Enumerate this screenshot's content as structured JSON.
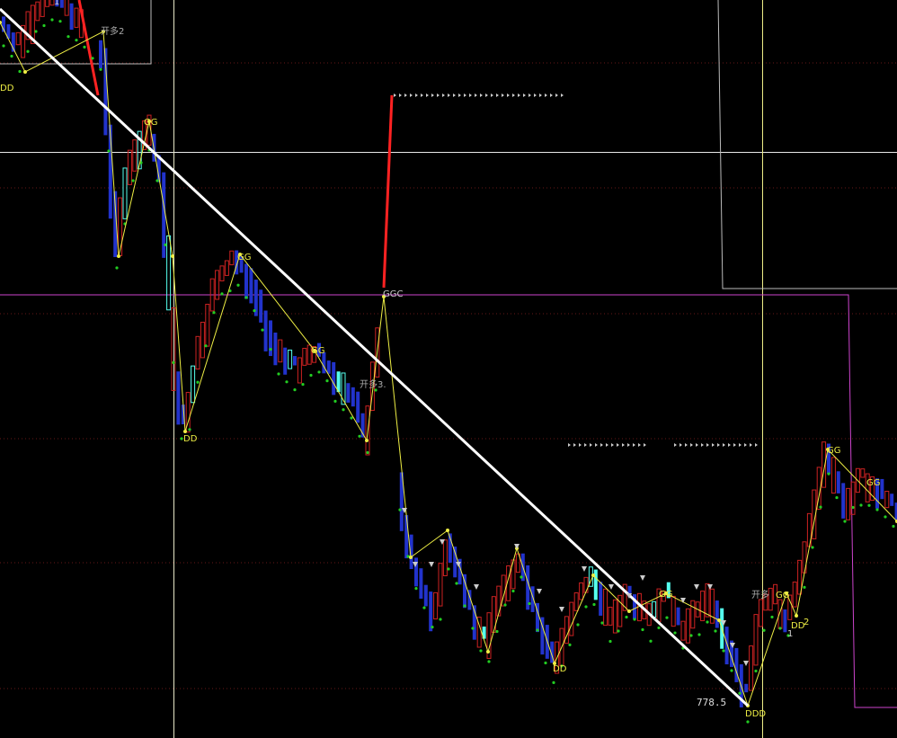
{
  "chart_data": {
    "type": "candlestick",
    "title": "",
    "xlabel": "",
    "ylabel": "",
    "grid": true,
    "colors": {
      "background": "#000000",
      "up_candle": "#cc2222",
      "down_candle": "#2233cc",
      "highlight_candle": "#55ffee",
      "trend_line": "#ffffff",
      "zigzag": "#eeee44",
      "dotted_trend": "#22cc22",
      "boundary_box": "#cc44cc",
      "vertical_marker": "#eeee88",
      "marker_text_top": "#eeee44",
      "marker_text_bottom": "#eeee44",
      "arrow_marker": "#cccccc",
      "spike": "#ff2222"
    },
    "price_label": "778.5",
    "annotations": [
      {
        "id": "dd1",
        "text": "DD"
      },
      {
        "id": "kd2",
        "text": "开多2"
      },
      {
        "id": "one1",
        "text": "1"
      },
      {
        "id": "gg1",
        "text": "GG"
      },
      {
        "id": "dd2",
        "text": "DD"
      },
      {
        "id": "ggc",
        "text": "GGC"
      },
      {
        "id": "gg2",
        "text": "GG"
      },
      {
        "id": "kd3",
        "text": "开多3."
      },
      {
        "id": "dd3",
        "text": "DD"
      },
      {
        "id": "gg3",
        "text": "GG"
      },
      {
        "id": "ddd",
        "text": "DDD"
      },
      {
        "id": "kd4",
        "text": "开多"
      },
      {
        "id": "gg4",
        "text": "GG"
      },
      {
        "id": "dd4",
        "text": "DD"
      },
      {
        "id": "two",
        "text": "2"
      },
      {
        "id": "one2",
        "text": "1"
      },
      {
        "id": "gg5",
        "text": "GG"
      }
    ]
  }
}
